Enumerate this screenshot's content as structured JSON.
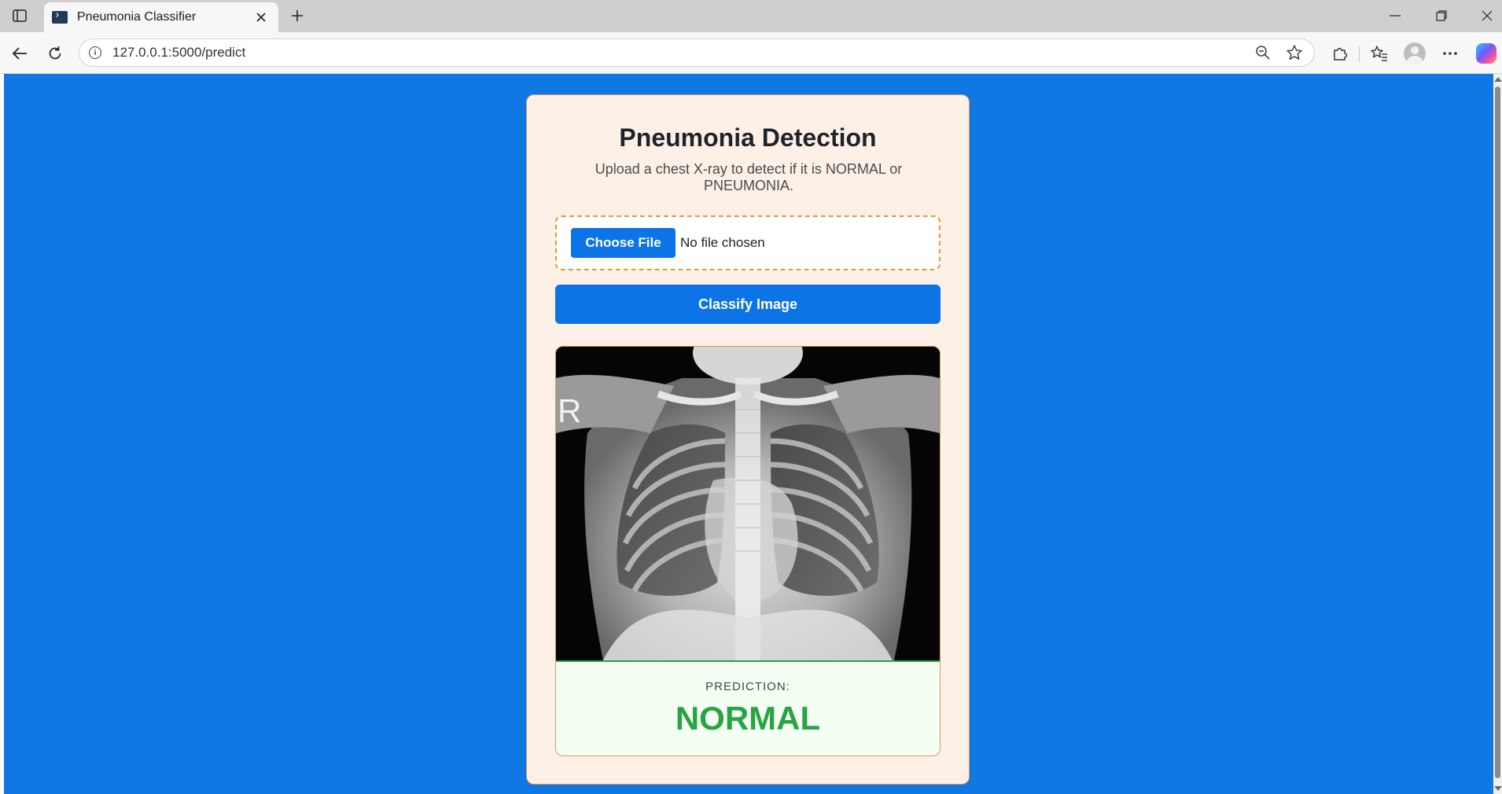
{
  "browser": {
    "tab_title": "Pneumonia Classifier",
    "url": "127.0.0.1:5000/predict"
  },
  "page": {
    "title": "Pneumonia Detection",
    "subtitle": "Upload a chest X-ray to detect if it is NORMAL or PNEUMONIA.",
    "file_input": {
      "button_label": "Choose File",
      "status": "No file chosen"
    },
    "classify_button": "Classify Image",
    "image_marker": "R",
    "prediction_label": "PREDICTION:",
    "prediction_value": "NORMAL"
  },
  "colors": {
    "page_background": "#0f78e2",
    "card_background": "#fdf1e7",
    "primary_button": "#0d74e8",
    "prediction_normal": "#2aa345",
    "dashed_border": "#e59a2e"
  },
  "icons": {
    "tab_actions": "tab-actions-icon",
    "favicon": "terminal-favicon-icon",
    "close_tab": "close-icon",
    "new_tab": "plus-icon",
    "minimize": "minimize-icon",
    "restore": "restore-icon",
    "close_window": "close-icon",
    "back": "back-arrow-icon",
    "refresh": "refresh-icon",
    "site_info": "info-icon",
    "zoom": "zoom-out-icon",
    "favorite": "star-icon",
    "extensions": "puzzle-icon",
    "favorites": "favorites-icon",
    "profile": "avatar",
    "more": "more-icon",
    "copilot": "copilot-icon"
  }
}
